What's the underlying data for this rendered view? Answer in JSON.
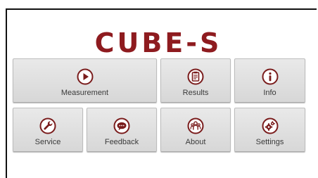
{
  "app": {
    "logo_text": "CUBE-S"
  },
  "menu": {
    "measurement": "Measurement",
    "results": "Results",
    "info": "Info",
    "service": "Service",
    "feedback": "Feedback",
    "about": "About",
    "settings": "Settings"
  },
  "icons": {
    "measurement": "play-icon",
    "results": "clipboard-icon",
    "info": "info-icon",
    "service": "wrench-icon",
    "feedback": "chat-bubble-icon",
    "about": "people-icon",
    "settings": "gears-icon"
  },
  "colors": {
    "brand": "#8e1b1f",
    "icon_fill": "#7a1c1c",
    "tile_bg": "#dcdcdc",
    "label_text": "#3a3a3a"
  }
}
